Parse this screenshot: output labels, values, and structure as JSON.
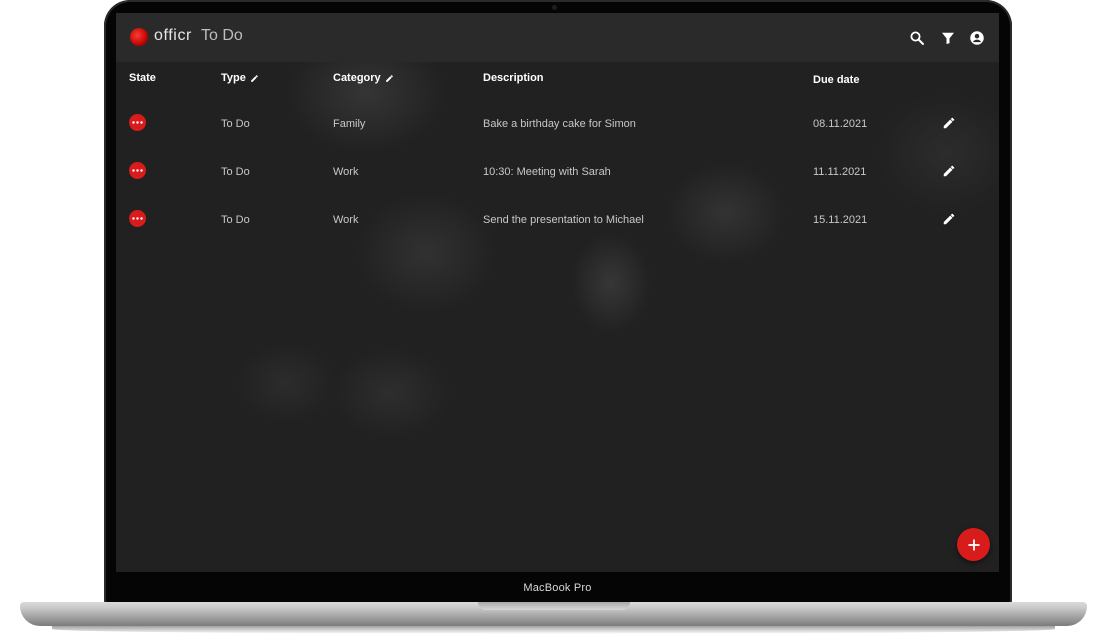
{
  "app": {
    "brand": "officr",
    "section_title": "To Do",
    "accent_color": "#d81b1b",
    "actions": [
      "search-icon",
      "filter-icon",
      "account-icon"
    ]
  },
  "table": {
    "headers": {
      "state": "State",
      "type": "Type",
      "category": "Category",
      "description": "Description",
      "due_date": "Due date"
    },
    "rows": [
      {
        "type": "To Do",
        "category": "Family",
        "description": "Bake a birthday cake for Simon",
        "due_date": "08.11.2021"
      },
      {
        "type": "To Do",
        "category": "Work",
        "description": "10:30: Meeting with Sarah",
        "due_date": "11.11.2021"
      },
      {
        "type": "To Do",
        "category": "Work",
        "description": "Send the presentation to Michael",
        "due_date": "15.11.2021"
      }
    ]
  },
  "device": {
    "label": "MacBook Pro"
  }
}
